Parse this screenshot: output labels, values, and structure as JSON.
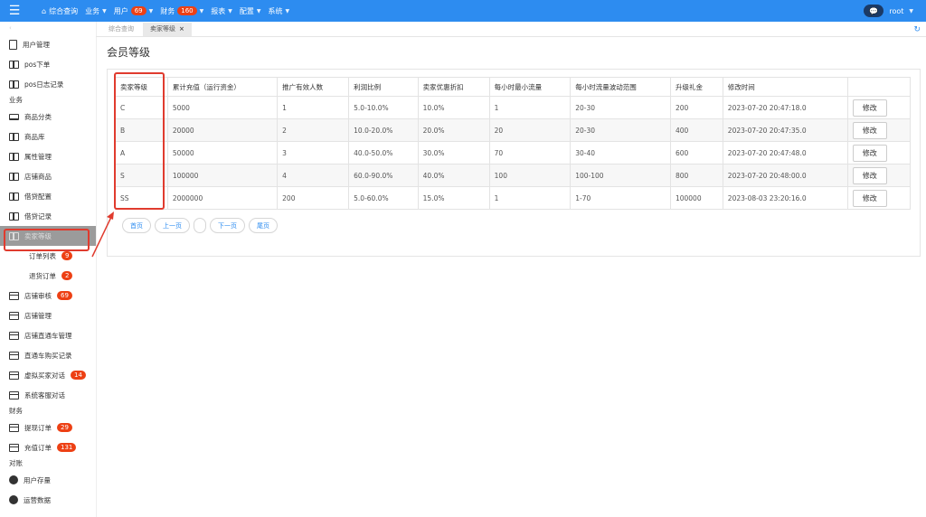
{
  "topbar": {
    "menu_icon": "menu-icon",
    "nav": [
      {
        "label": "综合查询",
        "icon": "home-icon"
      },
      {
        "label": "业务",
        "caret": true
      },
      {
        "label": "用户",
        "badge": "69",
        "caret": true
      },
      {
        "label": "财务",
        "badge": "160",
        "caret": true
      },
      {
        "label": "报表",
        "caret": true
      },
      {
        "label": "配置",
        "caret": true
      },
      {
        "label": "系统",
        "caret": true
      }
    ],
    "user": "root",
    "accent": "#2d8cf0",
    "badge_color": "#ed4014"
  },
  "sidebar": {
    "items": [
      {
        "label": "用户管理",
        "icon": "doc"
      },
      {
        "label": "pos下单",
        "icon": "split"
      },
      {
        "label": "pos日志记录",
        "icon": "split"
      },
      {
        "group": "业务"
      },
      {
        "label": "商品分类",
        "icon": "laptop"
      },
      {
        "label": "商品库",
        "icon": "split"
      },
      {
        "label": "属性管理",
        "icon": "split"
      },
      {
        "label": "店铺商品",
        "icon": "split"
      },
      {
        "label": "借贷配置",
        "icon": "split"
      },
      {
        "label": "借贷记录",
        "icon": "split"
      },
      {
        "label": "卖家等级",
        "icon": "split",
        "active": true
      },
      {
        "label": "订单列表",
        "sub": true,
        "badge": "9"
      },
      {
        "label": "退货订单",
        "sub": true,
        "badge": "2"
      },
      {
        "label": "店铺审核",
        "icon": "card",
        "badge": "69"
      },
      {
        "label": "店铺管理",
        "icon": "card"
      },
      {
        "label": "店铺直通车管理",
        "icon": "card"
      },
      {
        "label": "直通车购买记录",
        "icon": "card"
      },
      {
        "label": "虚拟买家对话",
        "icon": "card",
        "badge": "14"
      },
      {
        "label": "系统客服对话",
        "icon": "card"
      },
      {
        "group": "财务"
      },
      {
        "label": "提现订单",
        "icon": "card",
        "badge": "29"
      },
      {
        "label": "充值订单",
        "icon": "card",
        "badge": "131"
      },
      {
        "group": "对账"
      },
      {
        "label": "用户存量",
        "icon": "pie"
      },
      {
        "label": "运营数据",
        "icon": "pie"
      }
    ]
  },
  "tabs": [
    {
      "label": "综合查询",
      "active": false
    },
    {
      "label": "卖家等级",
      "active": true,
      "close": "×"
    }
  ],
  "page_title": "会员等级",
  "table": {
    "headers": [
      "卖家等级",
      "累计充值（运行资金）",
      "推广有效人数",
      "利润比例",
      "卖家优惠折扣",
      "每小时最小流量",
      "每小时流量波动范围",
      "升级礼金",
      "修改时间",
      ""
    ],
    "rows": [
      [
        "C",
        "5000",
        "1",
        "5.0-10.0%",
        "10.0%",
        "1",
        "20-30",
        "200",
        "2023-07-20 20:47:18.0"
      ],
      [
        "B",
        "20000",
        "2",
        "10.0-20.0%",
        "20.0%",
        "20",
        "20-30",
        "400",
        "2023-07-20 20:47:35.0"
      ],
      [
        "A",
        "50000",
        "3",
        "40.0-50.0%",
        "30.0%",
        "70",
        "30-40",
        "600",
        "2023-07-20 20:47:48.0"
      ],
      [
        "S",
        "100000",
        "4",
        "60.0-90.0%",
        "40.0%",
        "100",
        "100-100",
        "800",
        "2023-07-20 20:48:00.0"
      ],
      [
        "SS",
        "2000000",
        "200",
        "5.0-60.0%",
        "15.0%",
        "1",
        "1-70",
        "100000",
        "2023-08-03 23:20:16.0"
      ]
    ],
    "action_label": "修改"
  },
  "pager": {
    "first": "首页",
    "prev": "上一页",
    "current": "",
    "next": "下一页",
    "last": "尾页"
  }
}
